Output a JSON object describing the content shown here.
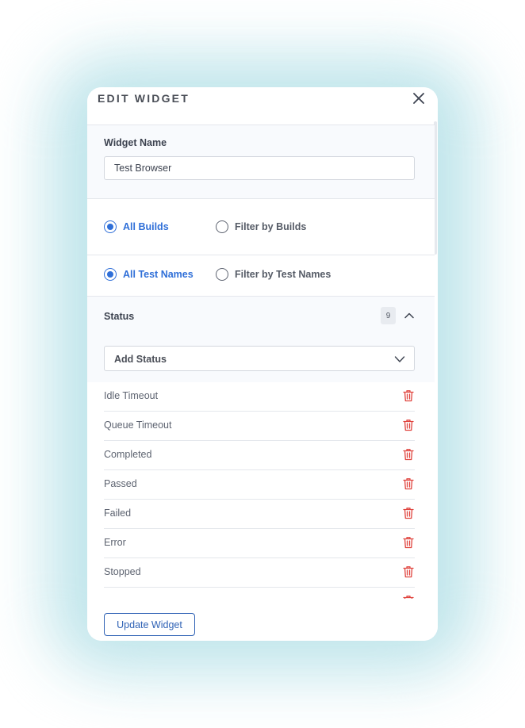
{
  "dialog": {
    "title": "EDIT WIDGET"
  },
  "widget_name": {
    "label": "Widget Name",
    "value": "Test Browser"
  },
  "builds": {
    "all_label": "All Builds",
    "filter_label": "Filter by Builds",
    "selected": "all"
  },
  "test_names": {
    "all_label": "All Test Names",
    "filter_label": "Filter by Test Names",
    "selected": "all"
  },
  "status": {
    "label": "Status",
    "count": "9",
    "add_placeholder": "Add Status",
    "items": [
      {
        "label": "Idle Timeout"
      },
      {
        "label": "Queue Timeout"
      },
      {
        "label": "Completed"
      },
      {
        "label": "Passed"
      },
      {
        "label": "Failed"
      },
      {
        "label": "Error"
      },
      {
        "label": "Stopped"
      }
    ]
  },
  "footer": {
    "update_label": "Update Widget"
  },
  "colors": {
    "accent": "#2f6fd8",
    "danger": "#e0443e",
    "glow": "#bde4ea"
  },
  "icons": {
    "close": "close-icon",
    "collapse": "chevron-up-icon",
    "select": "chevron-down-icon",
    "delete": "trash-icon"
  }
}
